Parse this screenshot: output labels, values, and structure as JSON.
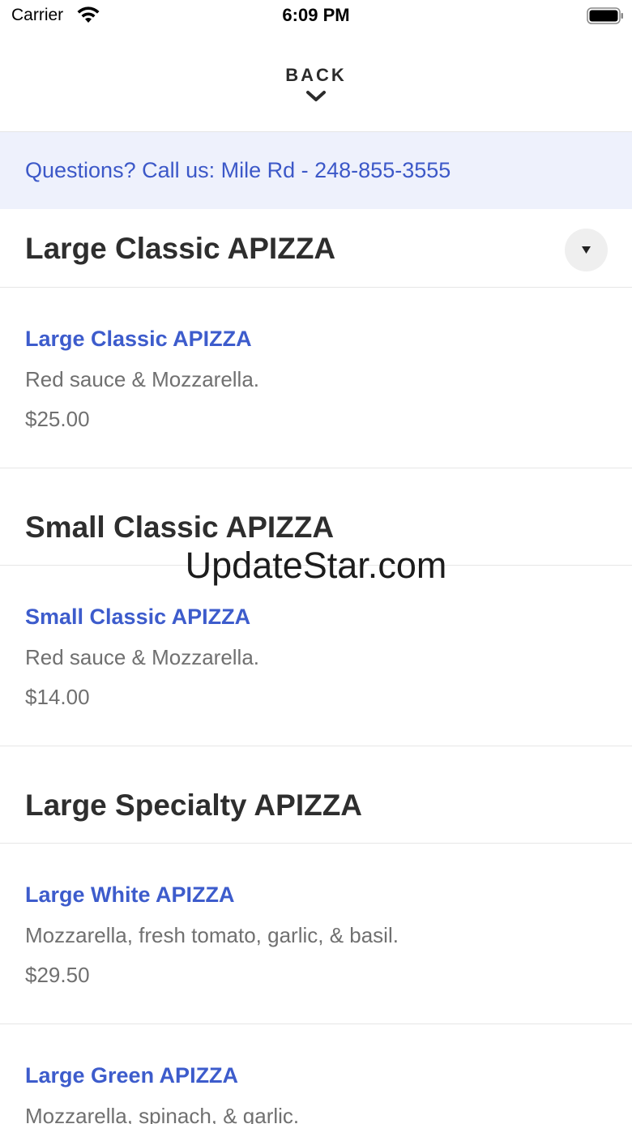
{
  "status_bar": {
    "carrier": "Carrier",
    "time": "6:09 PM"
  },
  "header": {
    "back_label": "BACK"
  },
  "banner": {
    "text": "Questions? Call us: Mile Rd - 248-855-3555"
  },
  "sections": [
    {
      "title": "Large Classic APIZZA",
      "items": [
        {
          "name": "Large Classic APIZZA",
          "description": "Red sauce & Mozzarella.",
          "price": "$25.00"
        }
      ]
    },
    {
      "title": "Small Classic APIZZA",
      "items": [
        {
          "name": "Small Classic APIZZA",
          "description": "Red sauce & Mozzarella.",
          "price": "$14.00"
        }
      ]
    },
    {
      "title": "Large Specialty APIZZA",
      "items": [
        {
          "name": "Large White APIZZA",
          "description": "Mozzarella, fresh tomato, garlic, & basil.",
          "price": "$29.50"
        },
        {
          "name": "Large Green APIZZA",
          "description": "Mozzarella, spinach, & garlic."
        }
      ]
    }
  ],
  "watermark": "UpdateStar.com",
  "colors": {
    "accent": "#3d5ccc",
    "banner_bg": "#eef1fc",
    "banner_text": "#3c58c8"
  }
}
